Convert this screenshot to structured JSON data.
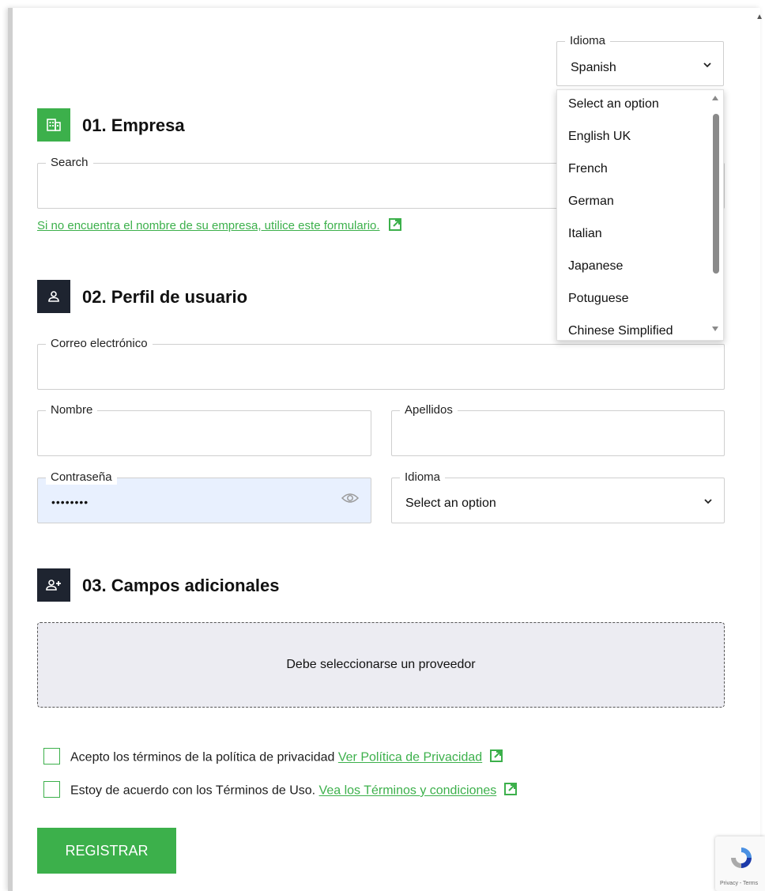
{
  "top_language": {
    "legend": "Idioma",
    "selected": "Spanish",
    "options": [
      "Select an option",
      "English UK",
      "French",
      "German",
      "Italian",
      "Japanese",
      "Potuguese",
      "Chinese Simplified"
    ]
  },
  "section1": {
    "title": "01. Empresa",
    "search_legend": "Search",
    "search_value": "",
    "help_link": "Si no encuentra el nombre de su empresa, utilice este formulario."
  },
  "section2": {
    "title": "02. Perfil de usuario",
    "email_legend": "Correo electrónico",
    "email_value": "",
    "first_name_legend": "Nombre",
    "last_name_legend": "Apellidos",
    "password_legend": "Contraseña",
    "password_value": "••••••••",
    "language_legend": "Idioma",
    "language_value": "Select an option"
  },
  "section3": {
    "title": "03. Campos adicionales",
    "notice": "Debe seleccionarse un proveedor"
  },
  "consents": {
    "privacy_text": "Acepto los términos de la política de privacidad",
    "privacy_link": "Ver Política de Privacidad",
    "terms_text": "Estoy de acuerdo con los Términos de Uso.",
    "terms_link": "Vea los Términos y condiciones"
  },
  "submit_label": "REGISTRAR",
  "recaptcha_text": "Privacy - Terms",
  "colors": {
    "accent_green": "#3cb04b",
    "dark_icon_bg": "#1e2430",
    "autofill_bg": "#e8f0fe",
    "notice_bg": "#ececf2"
  }
}
